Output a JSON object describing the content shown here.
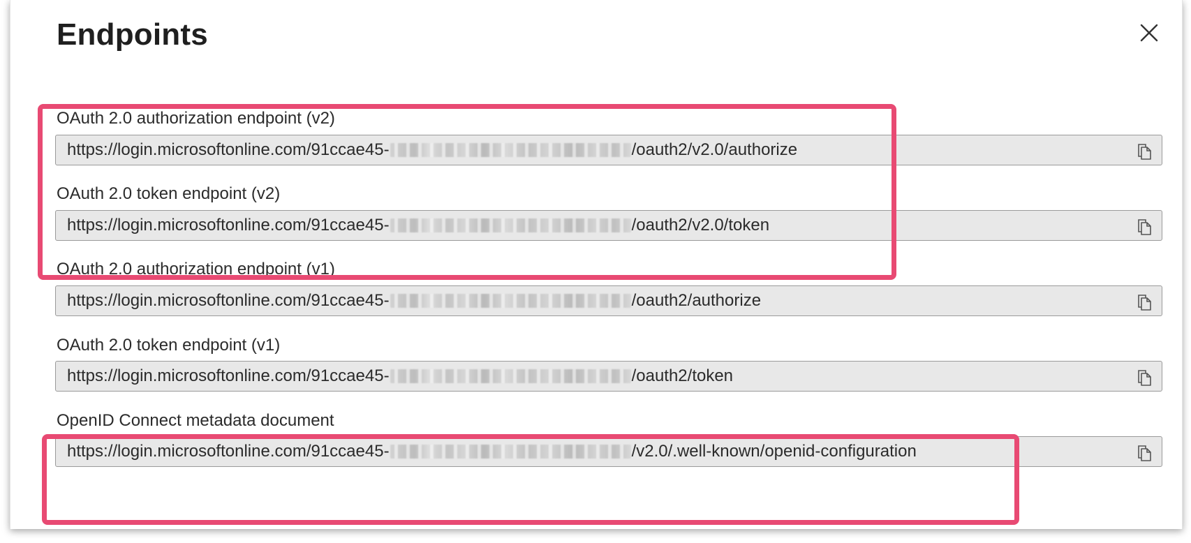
{
  "dialog": {
    "title": "Endpoints",
    "close_icon": "close-icon",
    "copy_icon": "copy-icon"
  },
  "endpoints": [
    {
      "label": "OAuth 2.0 authorization endpoint (v2)",
      "url_prefix": "https://login.microsoftonline.com/91ccae45-",
      "url_suffix": "/oauth2/v2.0/authorize"
    },
    {
      "label": "OAuth 2.0 token endpoint (v2)",
      "url_prefix": "https://login.microsoftonline.com/91ccae45-",
      "url_suffix": "/oauth2/v2.0/token"
    },
    {
      "label": "OAuth 2.0 authorization endpoint (v1)",
      "url_prefix": "https://login.microsoftonline.com/91ccae45-",
      "url_suffix": "/oauth2/authorize"
    },
    {
      "label": "OAuth 2.0 token endpoint (v1)",
      "url_prefix": "https://login.microsoftonline.com/91ccae45-",
      "url_suffix": "/oauth2/token"
    },
    {
      "label": "OpenID Connect metadata document",
      "url_prefix": "https://login.microsoftonline.com/91ccae45-",
      "url_suffix": "/v2.0/.well-known/openid-configuration"
    }
  ],
  "colors": {
    "highlight": "#e84a73",
    "field_background": "#e8e8e8",
    "field_border": "#9a9a9a",
    "text": "#2b2b2b"
  }
}
